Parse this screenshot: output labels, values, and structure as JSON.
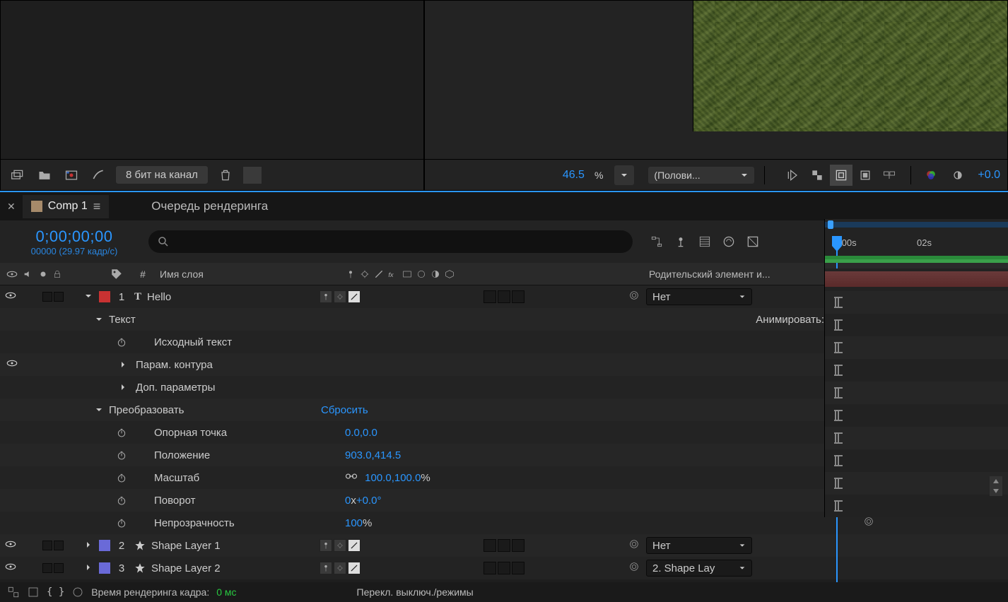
{
  "project_footer": {
    "bpc_label": "8 бит на канал"
  },
  "preview_footer": {
    "zoom": "46.5",
    "zoom_pct": "%",
    "resolution": "(Полови...",
    "exposure": "+0.0"
  },
  "tabs": {
    "active": "Comp 1",
    "render_queue": "Очередь рендеринга"
  },
  "timeline": {
    "timecode": "0;00;00;00",
    "frameinfo": "00000 (29.97 кадр/с)",
    "ruler": {
      "t0": ":00s",
      "t1": "02s"
    }
  },
  "columns": {
    "hash": "#",
    "layer_name": "Имя слоя",
    "parent": "Родительский элемент и..."
  },
  "layers": [
    {
      "num": "1",
      "name": "Hello",
      "color": "#c83232",
      "icon": "T",
      "parent": "Нет"
    },
    {
      "num": "2",
      "name": "Shape Layer 1",
      "color": "#6a6ad8",
      "icon": "star",
      "parent": "Нет"
    },
    {
      "num": "3",
      "name": "Shape Layer 2",
      "color": "#6a6ad8",
      "icon": "star",
      "parent": "2. Shape Lay"
    }
  ],
  "text_group": {
    "label": "Текст",
    "animate": "Анимировать:",
    "source_text": "Исходный текст",
    "path_opts": "Парам. контура",
    "more_opts": "Доп. параметры"
  },
  "transform": {
    "label": "Преобразовать",
    "reset": "Сбросить",
    "anchor": {
      "label": "Опорная точка",
      "value": "0.0,0.0"
    },
    "position": {
      "label": "Положение",
      "value": "903.0,414.5"
    },
    "scale": {
      "label": "Масштаб",
      "value": "100.0,100.0",
      "pct": "%"
    },
    "rotation": {
      "label": "Поворот",
      "prefix": "0",
      "x": "x",
      "value": "+0.0°"
    },
    "opacity": {
      "label": "Непрозрачность",
      "value": "100",
      "pct": "%"
    }
  },
  "bottom": {
    "render_time_label": "Время рендеринга кадра:",
    "render_time_val": "0 мс",
    "toggle_label": "Перекл. выключ./режимы"
  }
}
